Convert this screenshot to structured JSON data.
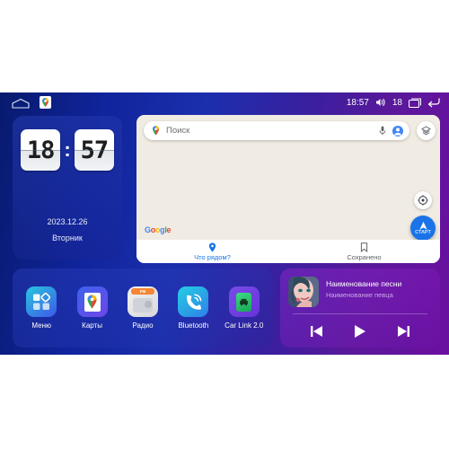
{
  "statusbar": {
    "home_icon": "home-icon",
    "maps_notification_icon": "google-maps-notification-icon",
    "time": "18:57",
    "volume_icon": "volume-icon",
    "volume_level": "18",
    "recents_icon": "recents-icon",
    "back_icon": "back-icon"
  },
  "clock_widget": {
    "hours": "18",
    "separator": ":",
    "minutes": "57",
    "date": "2023.12.26",
    "weekday": "Вторник"
  },
  "maps": {
    "search": {
      "placeholder": "Поиск",
      "pin_icon": "map-pin-icon",
      "mic_icon": "microphone-icon",
      "avatar_icon": "account-avatar-icon"
    },
    "layers_icon": "layers-icon",
    "compass_icon": "compass-icon",
    "start_button": {
      "label": "СТАРТ",
      "icon": "navigation-arrow-icon"
    },
    "watermark": "Google",
    "tabs": [
      {
        "label": "Что рядом?",
        "icon": "pin-icon",
        "active": true
      },
      {
        "label": "Сохранено",
        "icon": "bookmark-icon",
        "active": false
      }
    ]
  },
  "dock": {
    "apps": [
      {
        "label": "Меню",
        "icon": "apps-grid-icon"
      },
      {
        "label": "Карты",
        "icon": "google-maps-icon"
      },
      {
        "label": "Радио",
        "icon": "fm-radio-icon",
        "badge": "FM"
      },
      {
        "label": "Bluetooth",
        "icon": "bluetooth-phone-icon"
      },
      {
        "label": "Car Link 2.0",
        "icon": "car-link-icon"
      }
    ]
  },
  "music": {
    "title": "Наименование песни",
    "artist": "Наименование певца",
    "album_art_icon": "album-art-portrait",
    "controls": [
      {
        "name": "previous-button",
        "icon": "skip-previous-icon"
      },
      {
        "name": "play-button",
        "icon": "play-icon"
      },
      {
        "name": "next-button",
        "icon": "skip-next-icon"
      }
    ]
  },
  "colors": {
    "accent_blue": "#1a73e8",
    "bg_left": "#10249c",
    "bg_right": "#6a0fa0",
    "map_bg": "#f0ece3"
  }
}
